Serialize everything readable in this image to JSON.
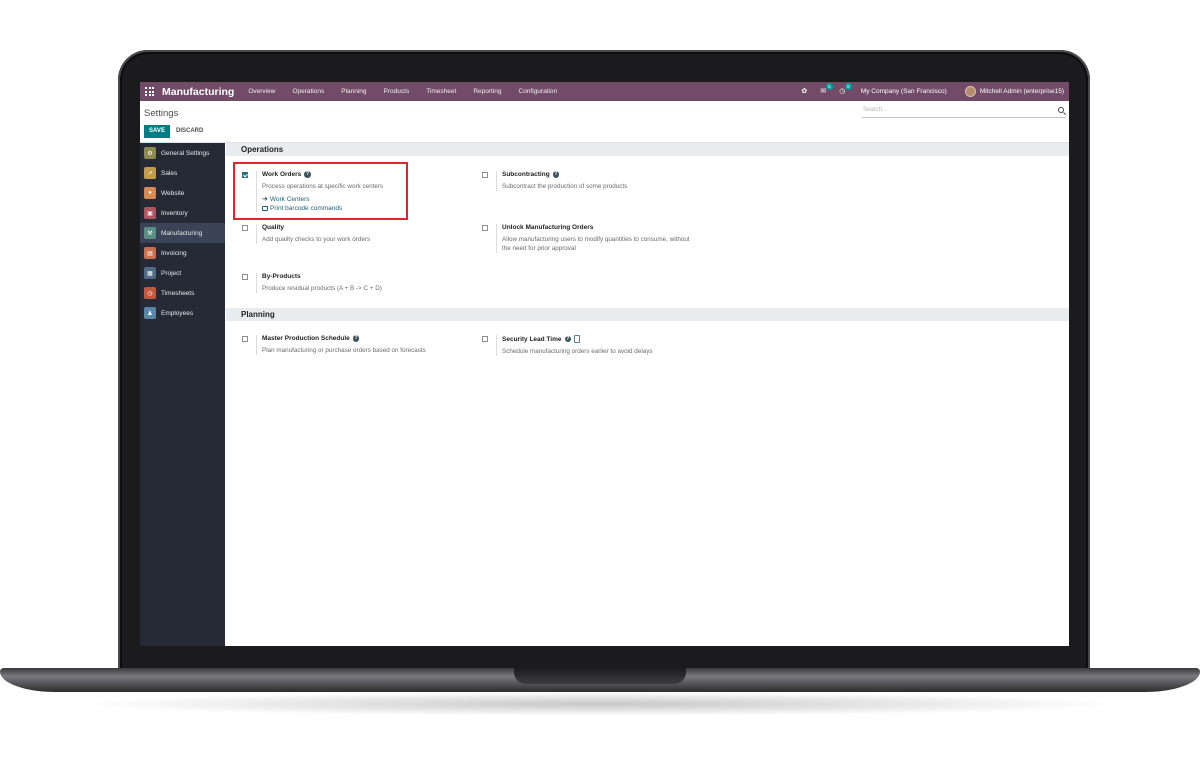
{
  "navbar": {
    "app_name": "Manufacturing",
    "menu": [
      "Overview",
      "Operations",
      "Planning",
      "Products",
      "Timesheet",
      "Reporting",
      "Configuration"
    ],
    "messages_badge": "5",
    "activities_badge": "8",
    "company": "My Company (San Francisco)",
    "user": "Mitchell Admin (enterprise15)",
    "brand_color": "#714b67"
  },
  "control_panel": {
    "title": "Settings",
    "save_label": "SAVE",
    "discard_label": "DISCARD",
    "search_placeholder": "Search..."
  },
  "sidebar": {
    "items": [
      {
        "label": "General Settings",
        "icon": "gear-icon",
        "color": "#8c8a4f"
      },
      {
        "label": "Sales",
        "icon": "chart-icon",
        "color": "#c29c4a"
      },
      {
        "label": "Website",
        "icon": "globe-icon",
        "color": "#d88a52"
      },
      {
        "label": "Inventory",
        "icon": "box-icon",
        "color": "#b1545f"
      },
      {
        "label": "Manufacturing",
        "icon": "wrench-icon",
        "color": "#5c8f84",
        "active": true
      },
      {
        "label": "Invoicing",
        "icon": "invoice-icon",
        "color": "#c8714f"
      },
      {
        "label": "Project",
        "icon": "puzzle-icon",
        "color": "#4f6b86"
      },
      {
        "label": "Timesheets",
        "icon": "clock-icon",
        "color": "#c3593c"
      },
      {
        "label": "Employees",
        "icon": "people-icon",
        "color": "#5a86a8"
      }
    ]
  },
  "sections": {
    "operations": {
      "title": "Operations",
      "work_orders": {
        "title": "Work Orders",
        "checked": true,
        "desc": "Process operations at specific work centers",
        "link1": "Work Centers",
        "link2": "Print barcode commands"
      },
      "subcontracting": {
        "title": "Subcontracting",
        "checked": false,
        "desc": "Subcontract the production of some products"
      },
      "quality": {
        "title": "Quality",
        "checked": false,
        "desc": "Add quality checks to your work orders"
      },
      "unlock": {
        "title": "Unlock Manufacturing Orders",
        "checked": false,
        "desc1": "Allow manufacturing users to modify quantities to consume, without",
        "desc2": "the need for prior approval"
      },
      "byproducts": {
        "title": "By-Products",
        "checked": false,
        "desc": "Produce residual products (A + B -> C + D)"
      }
    },
    "planning": {
      "title": "Planning",
      "mps": {
        "title": "Master Production Schedule",
        "checked": false,
        "desc": "Plan manufacturing or purchase orders based on forecasts"
      },
      "security_lead": {
        "title": "Security Lead Time",
        "checked": false,
        "desc": "Schedule manufacturing orders earlier to avoid delays"
      }
    }
  }
}
